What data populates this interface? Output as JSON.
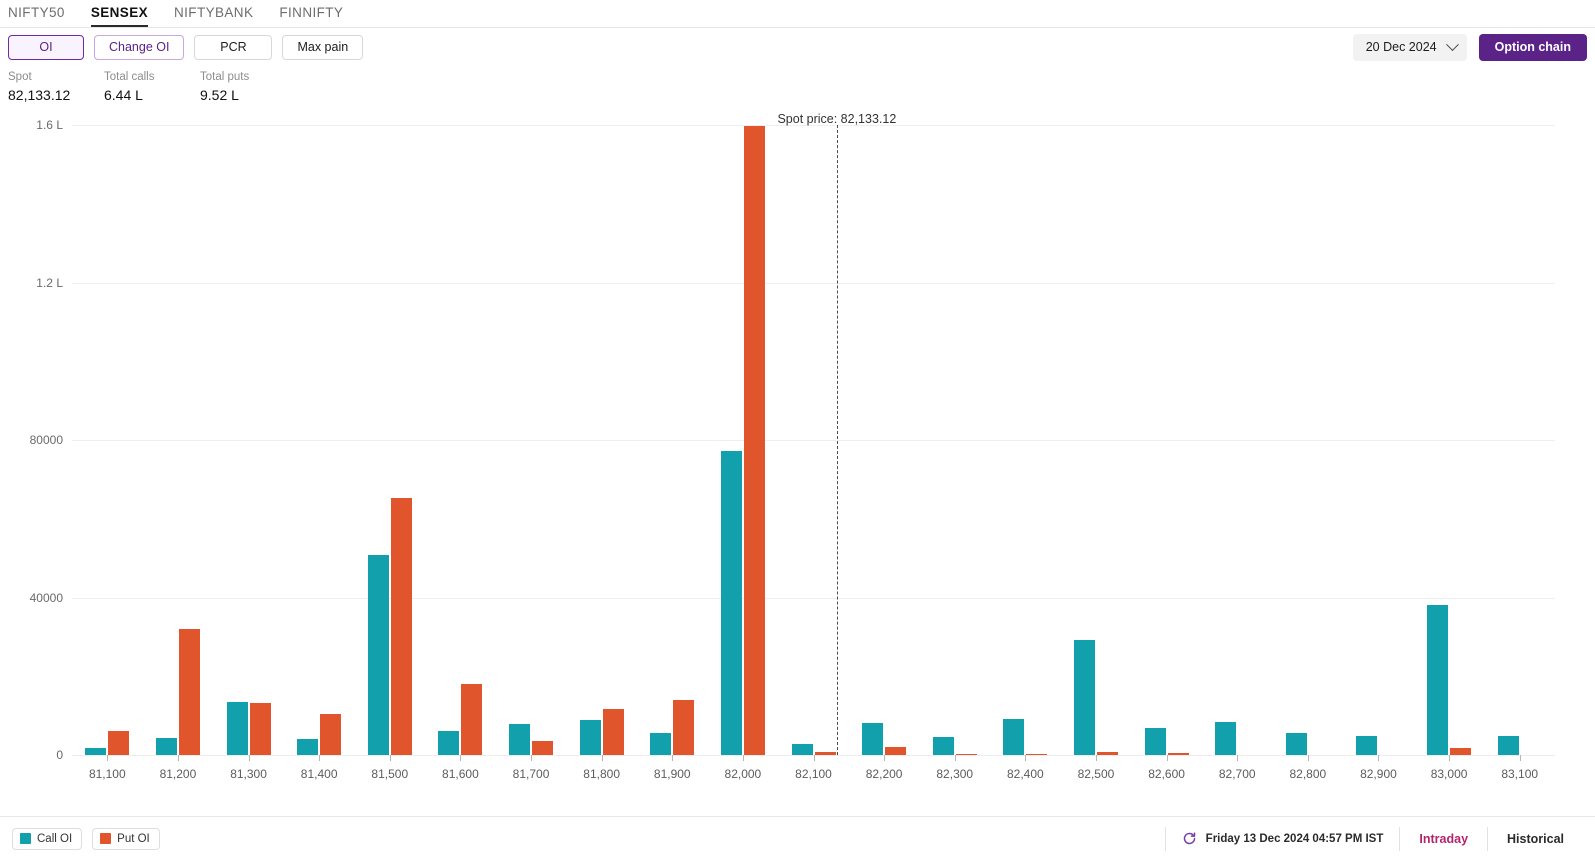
{
  "index_tabs": [
    {
      "label": "NIFTY50",
      "active": false
    },
    {
      "label": "SENSEX",
      "active": true
    },
    {
      "label": "NIFTYBANK",
      "active": false
    },
    {
      "label": "FINNIFTY",
      "active": false
    }
  ],
  "metric_pills": [
    {
      "label": "OI",
      "state": "selected"
    },
    {
      "label": "Change OI",
      "state": "outlined"
    },
    {
      "label": "PCR",
      "state": "plain"
    },
    {
      "label": "Max pain",
      "state": "plain"
    }
  ],
  "expiry_select": {
    "value": "20 Dec 2024",
    "icon": "chevron-down-icon"
  },
  "option_chain_button": {
    "label": "Option chain"
  },
  "stats": [
    {
      "label": "Spot",
      "value": "82,133.12"
    },
    {
      "label": "Total calls",
      "value": "6.44 L"
    },
    {
      "label": "Total puts",
      "value": "9.52 L"
    }
  ],
  "legend": [
    {
      "label": "Call OI",
      "color": "#13a0ad"
    },
    {
      "label": "Put OI",
      "color": "#e0552b"
    }
  ],
  "footer": {
    "refresh_icon": "refresh-icon",
    "timestamp": "Friday 13 Dec 2024 04:57 PM IST",
    "modes": [
      {
        "label": "Intraday",
        "active": true
      },
      {
        "label": "Historical",
        "active": false
      }
    ]
  },
  "chart_data": {
    "type": "bar",
    "title": "",
    "xlabel": "",
    "ylabel": "",
    "grid": true,
    "legend_position": "bottom-left",
    "ylim": [
      0,
      160000
    ],
    "ytick_values": [
      0,
      40000,
      80000,
      120000,
      160000
    ],
    "ytick_labels": [
      "0",
      "40000",
      "80000",
      "1.2 L",
      "1.6 L"
    ],
    "categories": [
      "81,100",
      "81,200",
      "81,300",
      "81,400",
      "81,500",
      "81,600",
      "81,700",
      "81,800",
      "81,900",
      "82,000",
      "82,100",
      "82,200",
      "82,300",
      "82,400",
      "82,500",
      "82,600",
      "82,700",
      "82,800",
      "82,900",
      "83,000",
      "83,100"
    ],
    "series": [
      {
        "name": "Call OI",
        "color": "#13a0ad",
        "values": [
          1700,
          4300,
          13500,
          4000,
          50900,
          6200,
          8000,
          8800,
          5700,
          77300,
          2700,
          8100,
          4600,
          9150,
          29300,
          6750,
          8350,
          5700,
          4800,
          38100,
          4900
        ]
      },
      {
        "name": "Put OI",
        "color": "#e0552b",
        "values": [
          6100,
          31900,
          13250,
          10500,
          65300,
          18000,
          3500,
          11700,
          14000,
          159700,
          800,
          2050,
          350,
          250,
          800,
          450,
          0,
          0,
          0,
          1900,
          0
        ]
      }
    ],
    "annotations": [
      {
        "type": "vline",
        "label": "Spot price: 82,133.12",
        "x_value": 82133.12,
        "style": "dashed"
      }
    ]
  }
}
